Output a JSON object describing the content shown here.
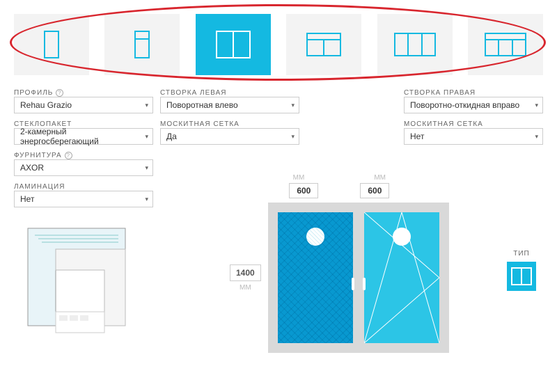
{
  "types": {
    "selected_index": 2
  },
  "profile": {
    "label": "ПРОФИЛЬ",
    "value": "Rehau Grazio"
  },
  "glazing": {
    "label": "СТЕКЛОПАКЕТ",
    "value": "2-камерный энергосберегающий"
  },
  "hardware": {
    "label": "ФУРНИТУРА",
    "value": "AXOR"
  },
  "lamination": {
    "label": "ЛАМИНАЦИЯ",
    "value": "Нет"
  },
  "sash_left": {
    "label": "СТВОРКА ЛЕВАЯ",
    "value": "Поворотная влево"
  },
  "mesh_left": {
    "label": "МОСКИТНАЯ СЕТКА",
    "value": "Да"
  },
  "sash_right": {
    "label": "СТВОРКА ПРАВАЯ",
    "value": "Поворотно-откидная вправо"
  },
  "mesh_right": {
    "label": "МОСКИТНАЯ СЕТКА",
    "value": "Нет"
  },
  "dims": {
    "mm": "ММ",
    "w1": "600",
    "w2": "600",
    "h": "1400"
  },
  "type_badge": {
    "label": "ТИП"
  }
}
